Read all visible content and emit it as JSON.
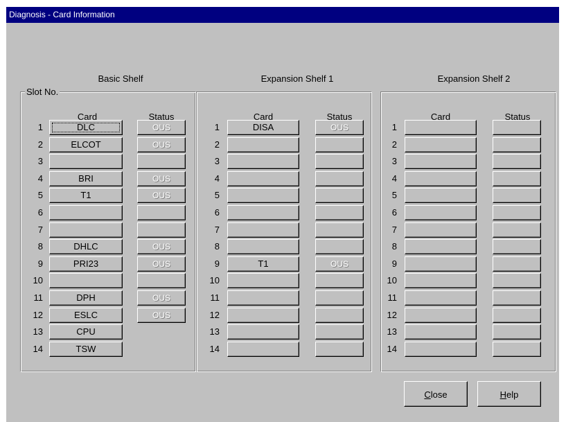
{
  "window": {
    "title": "Diagnosis - Card Information"
  },
  "columns": {
    "card": "Card",
    "status": "Status"
  },
  "basic": {
    "title": "Basic Shelf",
    "legend": "Slot No.",
    "slots": [
      {
        "num": "1",
        "card": "DLC",
        "status": "OUS"
      },
      {
        "num": "2",
        "card": "ELCOT",
        "status": "OUS"
      },
      {
        "num": "3",
        "card": "",
        "status": ""
      },
      {
        "num": "4",
        "card": "BRI",
        "status": "OUS"
      },
      {
        "num": "5",
        "card": "T1",
        "status": "OUS"
      },
      {
        "num": "6",
        "card": "",
        "status": ""
      },
      {
        "num": "7",
        "card": "",
        "status": ""
      },
      {
        "num": "8",
        "card": "DHLC",
        "status": "OUS"
      },
      {
        "num": "9",
        "card": "PRI23",
        "status": "OUS"
      },
      {
        "num": "10",
        "card": "",
        "status": ""
      },
      {
        "num": "11",
        "card": "DPH",
        "status": "OUS"
      },
      {
        "num": "12",
        "card": "ESLC",
        "status": "OUS"
      },
      {
        "num": "13",
        "card": "CPU",
        "status": null
      },
      {
        "num": "14",
        "card": "TSW",
        "status": null
      }
    ]
  },
  "exp1": {
    "title": "Expansion Shelf 1",
    "slots": [
      {
        "num": "1",
        "card": "DISA",
        "status": "OUS"
      },
      {
        "num": "2",
        "card": "",
        "status": ""
      },
      {
        "num": "3",
        "card": "",
        "status": ""
      },
      {
        "num": "4",
        "card": "",
        "status": ""
      },
      {
        "num": "5",
        "card": "",
        "status": ""
      },
      {
        "num": "6",
        "card": "",
        "status": ""
      },
      {
        "num": "7",
        "card": "",
        "status": ""
      },
      {
        "num": "8",
        "card": "",
        "status": ""
      },
      {
        "num": "9",
        "card": "T1",
        "status": "OUS"
      },
      {
        "num": "10",
        "card": "",
        "status": ""
      },
      {
        "num": "11",
        "card": "",
        "status": ""
      },
      {
        "num": "12",
        "card": "",
        "status": ""
      },
      {
        "num": "13",
        "card": "",
        "status": ""
      },
      {
        "num": "14",
        "card": "",
        "status": ""
      }
    ]
  },
  "exp2": {
    "title": "Expansion Shelf 2",
    "slots": [
      {
        "num": "1",
        "card": "",
        "status": ""
      },
      {
        "num": "2",
        "card": "",
        "status": ""
      },
      {
        "num": "3",
        "card": "",
        "status": ""
      },
      {
        "num": "4",
        "card": "",
        "status": ""
      },
      {
        "num": "5",
        "card": "",
        "status": ""
      },
      {
        "num": "6",
        "card": "",
        "status": ""
      },
      {
        "num": "7",
        "card": "",
        "status": ""
      },
      {
        "num": "8",
        "card": "",
        "status": ""
      },
      {
        "num": "9",
        "card": "",
        "status": ""
      },
      {
        "num": "10",
        "card": "",
        "status": ""
      },
      {
        "num": "11",
        "card": "",
        "status": ""
      },
      {
        "num": "12",
        "card": "",
        "status": ""
      },
      {
        "num": "13",
        "card": "",
        "status": ""
      },
      {
        "num": "14",
        "card": "",
        "status": ""
      }
    ]
  },
  "buttons": {
    "close": {
      "mnemonic": "C",
      "rest": "lose"
    },
    "help": {
      "mnemonic": "H",
      "rest": "elp"
    }
  },
  "focus": {
    "shelf": "basic",
    "slot": 0
  },
  "colors": {
    "title_bar": "#000080",
    "face": "#c0c0c0",
    "disabled_text": "#ffffff"
  }
}
